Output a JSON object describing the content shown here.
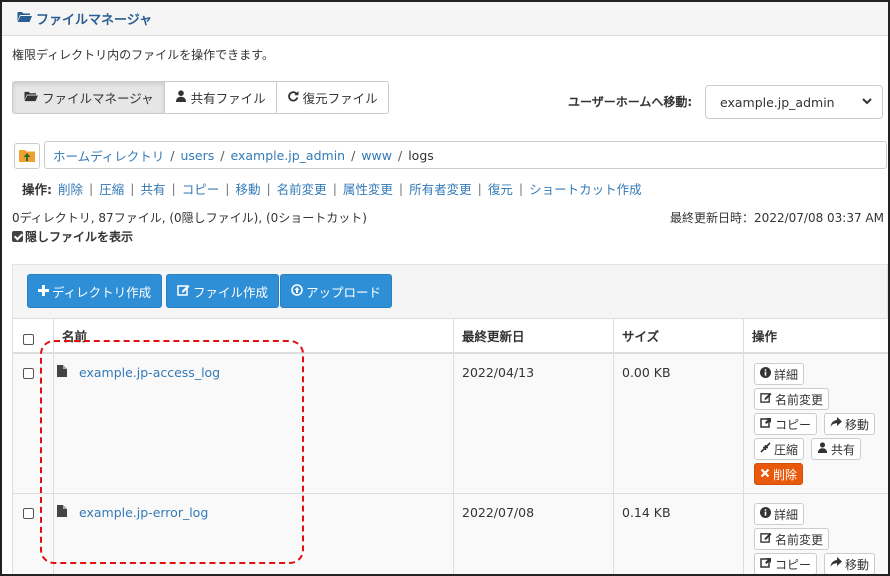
{
  "header": {
    "title": "ファイルマネージャ",
    "icon": "folder-open-icon"
  },
  "description": "権限ディレクトリ内のファイルを操作できます。",
  "tabs": [
    {
      "label": "ファイルマネージャ",
      "icon": "folder-open-icon",
      "active": true
    },
    {
      "label": "共有ファイル",
      "icon": "user-icon",
      "active": false
    },
    {
      "label": "復元ファイル",
      "icon": "refresh-icon",
      "active": false
    }
  ],
  "home_move": {
    "label": "ユーザーホームへ移動:",
    "selected": "example.jp_admin"
  },
  "breadcrumb": {
    "items": [
      "ホームディレクトリ",
      "users",
      "example.jp_admin",
      "www"
    ],
    "current": "logs",
    "separator": "/"
  },
  "operations": {
    "label": "操作:",
    "items": [
      "削除",
      "圧縮",
      "共有",
      "コピー",
      "移動",
      "名前変更",
      "属性変更",
      "所有者変更",
      "復元",
      "ショートカット作成"
    ]
  },
  "summary": {
    "counts": "0ディレクトリ, 87ファイル, (0隠しファイル), (0ショートカット)",
    "updated": "最終更新日時：2022/07/08 03:37 AM",
    "show_hidden": "隠しファイルを表示"
  },
  "toolbar": {
    "create_dir": "ディレクトリ作成",
    "create_file": "ファイル作成",
    "upload": "アップロード"
  },
  "table": {
    "headers": {
      "name": "名前",
      "modified": "最終更新日",
      "size": "サイズ",
      "actions": "操作"
    },
    "rows": [
      {
        "name": "example.jp-access_log",
        "modified": "2022/04/13",
        "size": "0.00 KB"
      },
      {
        "name": "example.jp-error_log",
        "modified": "2022/07/08",
        "size": "0.14 KB"
      }
    ],
    "actions": {
      "detail": "詳細",
      "rename": "名前変更",
      "copy": "コピー",
      "move": "移動",
      "compress": "圧縮",
      "share": "共有",
      "delete": "削除"
    }
  },
  "colors": {
    "primary": "#2e8fd6",
    "danger": "#e8590c",
    "link": "#337ab7",
    "highlight": "#e01010"
  }
}
